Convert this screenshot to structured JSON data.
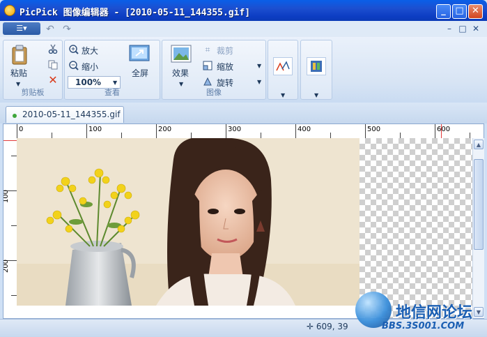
{
  "window": {
    "title": "PicPick 图像编辑器 - [2010-05-11_144355.gif]",
    "controls": {
      "minimize": "_",
      "maximize": "□",
      "close": "✕"
    }
  },
  "qat": {
    "menu_glyph": "☰▾",
    "undo_glyph": "↶",
    "redo_glyph": "↷",
    "mdi": {
      "minimize": "–",
      "restore": "□",
      "close": "✕"
    }
  },
  "ribbon": {
    "clipboard": {
      "paste_label": "粘贴",
      "group_label": "剪贴板"
    },
    "view": {
      "zoom_in_label": "放大",
      "zoom_out_label": "缩小",
      "zoom_value": "100%",
      "fullscreen_label": "全屏",
      "group_label": "查看"
    },
    "image": {
      "effects_label": "效果",
      "crop_label": "裁剪",
      "resize_label": "缩放",
      "rotate_label": "旋转",
      "group_label": "图像"
    }
  },
  "tabs": [
    {
      "label": "2010-05-11_144355.gif"
    }
  ],
  "rulers": {
    "h_labels": [
      "0",
      "100",
      "200",
      "300",
      "400",
      "500",
      "600"
    ],
    "v_labels": [
      "100",
      "200"
    ]
  },
  "status": {
    "cursor_glyph": "✛",
    "coordinates": "609, 39"
  },
  "watermark": {
    "name": "地信网论坛",
    "url": "BBS.3S001.COM"
  },
  "colors": {
    "titlebar": "#0c3cc2",
    "ribbon": "#d7e4f4",
    "accent": "#1e395b",
    "ruler_marker": "#e23a3a"
  }
}
